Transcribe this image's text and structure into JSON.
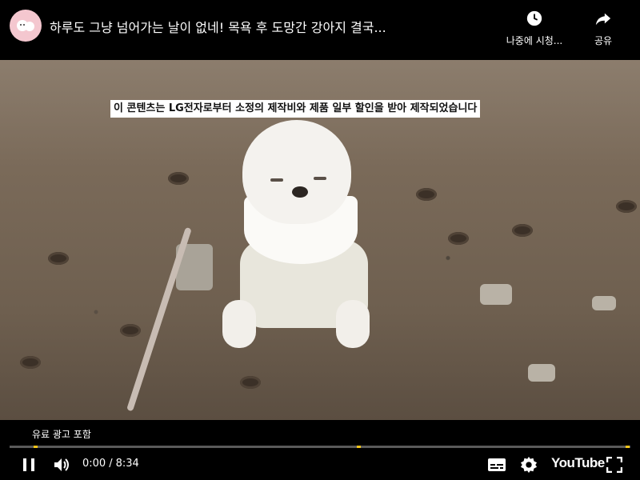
{
  "header": {
    "title": "하루도 그냥 넘어가는 날이 없네! 목욕 후 도망간 강아지 결국...",
    "watch_later_label": "나중에 시청...",
    "share_label": "공유"
  },
  "video": {
    "subtitle": "이 콘텐츠는 LG전자로부터 소정의 제작비와 제품 일부 할인을 받아 제작되었습니다"
  },
  "player": {
    "ad_notice": "유료 광고 포함",
    "current_time": "0:00",
    "time_separator": "/",
    "duration": "8:34",
    "progress_fraction": 0.0,
    "logo_text": "YouTube"
  },
  "colors": {
    "progress_played": "#ff0000",
    "ad_marker": "#f5c518",
    "avatar_bg": "#f4c7cf"
  },
  "icons": {
    "watch_later": "clock-icon",
    "share": "share-arrow-icon",
    "play": "pause-icon",
    "volume": "volume-icon",
    "captions": "captions-icon",
    "settings": "gear-icon",
    "fullscreen": "fullscreen-icon"
  }
}
